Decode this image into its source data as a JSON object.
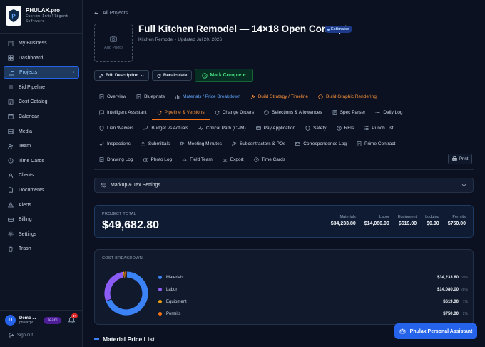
{
  "brand": {
    "name": "PHULAX.pro",
    "tagline_line1": "Custom Intelligent",
    "tagline_line2": "Software",
    "logo_letter": "P"
  },
  "sidebar": {
    "items": [
      {
        "label": "My Business",
        "icon": "building-icon"
      },
      {
        "label": "Dashboard",
        "icon": "dashboard-icon"
      },
      {
        "label": "Projects",
        "icon": "folder-icon",
        "active": true
      },
      {
        "label": "Bid Pipeline",
        "icon": "pipeline-icon"
      },
      {
        "label": "Cost Catalog",
        "icon": "catalog-icon"
      },
      {
        "label": "Calendar",
        "icon": "calendar-icon"
      },
      {
        "label": "Media",
        "icon": "media-icon"
      },
      {
        "label": "Team",
        "icon": "team-icon"
      },
      {
        "label": "Time Cards",
        "icon": "clock-icon"
      },
      {
        "label": "Clients",
        "icon": "clients-icon"
      },
      {
        "label": "Documents",
        "icon": "document-icon"
      },
      {
        "label": "Alerts",
        "icon": "alert-icon"
      },
      {
        "label": "Billing",
        "icon": "billing-icon"
      },
      {
        "label": "Settings",
        "icon": "gear-icon"
      },
      {
        "label": "Trash",
        "icon": "trash-icon"
      }
    ],
    "active_chevron": "›"
  },
  "user": {
    "initial": "D",
    "name": "Demo ...",
    "sub": "phulaxpr...",
    "team_badge": "Team",
    "notif_count": "9+",
    "signout": "Sign out"
  },
  "header": {
    "back_label": "All Projects",
    "photo_label": "Add Photo",
    "title": "Full Kitchen Remodel — 14×18 Open Concept",
    "status_badge": "Estimated",
    "subtitle": "Kitchen Remodel · Updated Jul 20, 2026"
  },
  "actions": {
    "edit": "Edit Description",
    "recalc": "Recalculate",
    "complete": "Mark Complete"
  },
  "tabs": {
    "row1": [
      "Overview",
      "Blueprints",
      "Materials / Price Breakdown",
      "Build Strategy / Timeline",
      "Build Graphic Rendering"
    ],
    "row2": [
      "Intelligent Assistant",
      "Pipeline & Versions",
      "Change Orders",
      "Selections & Allowances",
      "Spec Parser",
      "Daily Log"
    ],
    "row3": [
      "Lien Waivers",
      "Budget vs Actuals",
      "Critical Path (CPM)",
      "Pay Application",
      "Safety",
      "RFIs",
      "Punch List"
    ],
    "row4": [
      "Inspections",
      "Submittals",
      "Meeting Minutes",
      "Subcontractors & POs",
      "Correspondence Log",
      "Prime Contract"
    ],
    "row5": [
      "Drawing Log",
      "Photo Log",
      "Field Team",
      "Export",
      "Time Cards"
    ],
    "print": "Print"
  },
  "markup": {
    "label": "Markup & Tax Settings"
  },
  "total": {
    "label": "PROJECT TOTAL",
    "value": "$49,682.80",
    "stats": [
      {
        "label": "Materials",
        "value": "$34,233.80"
      },
      {
        "label": "Labor",
        "value": "$14,080.00"
      },
      {
        "label": "Equipment",
        "value": "$619.00"
      },
      {
        "label": "Lodging",
        "value": "$0.00"
      },
      {
        "label": "Permits",
        "value": "$750.00"
      }
    ]
  },
  "breakdown": {
    "label": "COST BREAKDOWN",
    "items": [
      {
        "label": "Materials",
        "value": "$34,233.80",
        "pct": "69%",
        "color": "#3b82f6"
      },
      {
        "label": "Labor",
        "value": "$14,080.00",
        "pct": "28%",
        "color": "#8b5cf6"
      },
      {
        "label": "Equipment",
        "value": "$619.00",
        "pct": "1%",
        "color": "#f59e0b"
      },
      {
        "label": "Permits",
        "value": "$750.00",
        "pct": "2%",
        "color": "#f97316"
      }
    ]
  },
  "chart_data": {
    "type": "pie",
    "categories": [
      "Materials",
      "Labor",
      "Equipment",
      "Permits"
    ],
    "values": [
      34233.8,
      14080.0,
      619.0,
      750.0
    ],
    "colors": [
      "#3b82f6",
      "#8b5cf6",
      "#f59e0b",
      "#f97316"
    ]
  },
  "price_list": {
    "label": "Material Price List"
  },
  "assistant": {
    "label": "Phulax Personal Assistant"
  },
  "colors": {
    "accent": "#2563eb",
    "orange_accent": "#f97316",
    "success": "#4ade80",
    "background": "#0b1120"
  }
}
